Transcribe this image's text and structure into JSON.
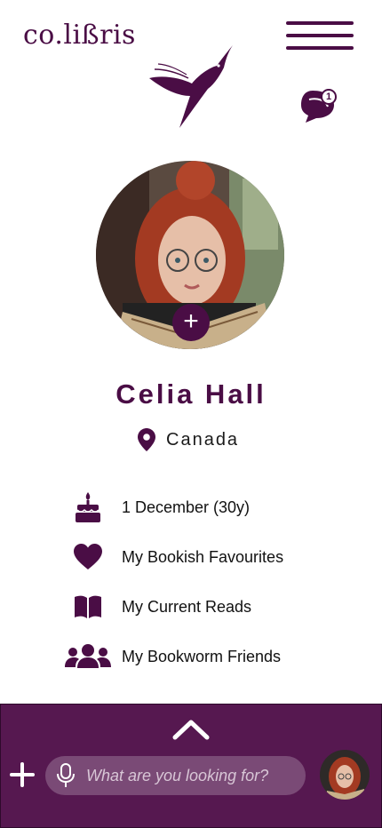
{
  "app": {
    "logo": "co.lißris",
    "brand_color": "#4a0d45",
    "bar_color": "#561850"
  },
  "header": {
    "menu_icon": "hamburger-icon",
    "bird_icon": "hummingbird-icon",
    "chat_icon": "chat-bubbles-icon",
    "chat_badge": "1"
  },
  "profile": {
    "name": "Celia Hall",
    "location": "Canada",
    "avatar_add": "+"
  },
  "details": [
    {
      "icon": "cake-icon",
      "label": "1 December (30y)"
    },
    {
      "icon": "heart-icon",
      "label": "My Bookish Favourites"
    },
    {
      "icon": "book-icon",
      "label": "My Current Reads"
    },
    {
      "icon": "friends-icon",
      "label": "My Bookworm Friends"
    }
  ],
  "bottom_bar": {
    "expand_icon": "chevron-up-icon",
    "add_icon": "plus-icon",
    "mic_icon": "microphone-icon",
    "search_placeholder": "What are you looking for?"
  }
}
